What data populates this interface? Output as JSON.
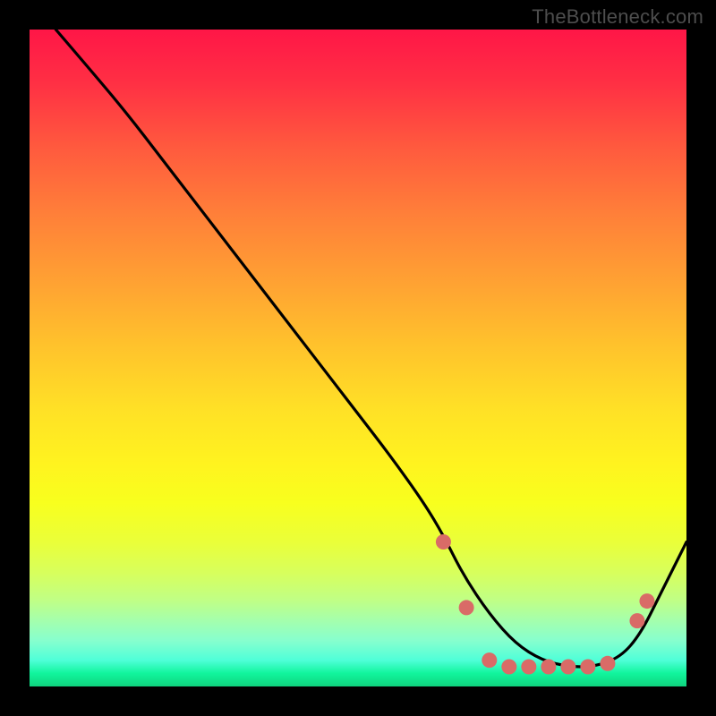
{
  "watermark": "TheBottleneck.com",
  "chart_data": {
    "type": "line",
    "title": "",
    "xlabel": "",
    "ylabel": "",
    "xlim": [
      0,
      100
    ],
    "ylim": [
      0,
      100
    ],
    "series": [
      {
        "name": "curve",
        "color": "#000000",
        "x": [
          4,
          10,
          15,
          20,
          25,
          30,
          35,
          40,
          45,
          50,
          55,
          60,
          63,
          66,
          70,
          74,
          78,
          82,
          86,
          90,
          93,
          96,
          100
        ],
        "values": [
          100,
          93,
          87,
          80.5,
          74,
          67.5,
          61,
          54.5,
          48,
          41.5,
          35,
          28,
          23,
          17,
          11,
          6.5,
          4,
          3,
          3,
          4.5,
          8,
          14,
          22
        ]
      }
    ],
    "markers": {
      "name": "highlight-points",
      "color": "#d96b67",
      "radius": 8.5,
      "x": [
        63,
        66.5,
        70,
        73,
        76,
        79,
        82,
        85,
        88,
        92.5,
        94
      ],
      "values": [
        22,
        12,
        4,
        3,
        3,
        3,
        3,
        3,
        3.5,
        10,
        13
      ]
    }
  }
}
